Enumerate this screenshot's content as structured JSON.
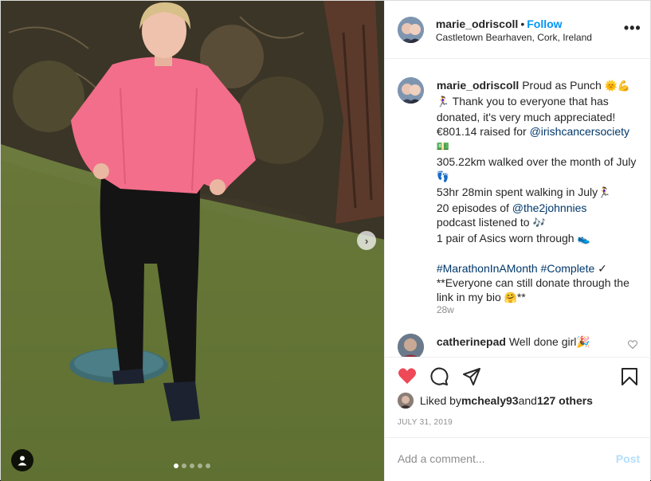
{
  "header": {
    "username": "marie_odriscoll",
    "separator": "•",
    "follow_label": "Follow",
    "location": "Castletown Bearhaven, Cork, Ireland",
    "more_label": "•••"
  },
  "caption": {
    "username": "marie_odriscoll",
    "line1_text": "Proud as Punch ",
    "line1_emoji": "🌞💪",
    "line2_emoji": "🏃‍♀",
    "line2_text": " Thank you to everyone that has donated, it's very much appreciated!",
    "line3_text": "€801.14 raised for ",
    "line3_mention": "@irishcancersociety",
    "line3_emoji": "💵",
    "line4_text": "305.22km walked over the month of July ",
    "line4_emoji": "👣",
    "line5_text": "53hr 28min spent walking in July",
    "line5_emoji": "🏃‍♀",
    "line6_text": "20 episodes of ",
    "line6_mention": "@the2johnnies",
    "line7_text": "podcast listened to ",
    "line7_emoji": "🎶",
    "line8_text": "1 pair of Asics worn through ",
    "line8_emoji": "👟",
    "hashtags": "#MarathonInAMonth #Complete",
    "check": " ✓",
    "line10_text": "**Everyone can still donate through the link in my bio ",
    "line10_emoji": "🤗",
    "line10_end": "**"
  },
  "age": "28w",
  "comment": {
    "username": "catherinepad",
    "text": "Well done girl",
    "emoji": "🎉"
  },
  "likes": {
    "prefix": "Liked by ",
    "user": "mchealy93",
    "middle": " and ",
    "count": "127 others"
  },
  "date": "JULY 31, 2019",
  "add_comment": {
    "placeholder": "Add a comment...",
    "post_label": "Post"
  },
  "carousel": {
    "next_label": "›",
    "total_slides": 5,
    "active_slide": 1
  },
  "colors": {
    "like_red": "#ed4956",
    "follow_blue": "#0095f6",
    "mention_blue": "#00376b",
    "post_disabled": "#b2dffc"
  }
}
